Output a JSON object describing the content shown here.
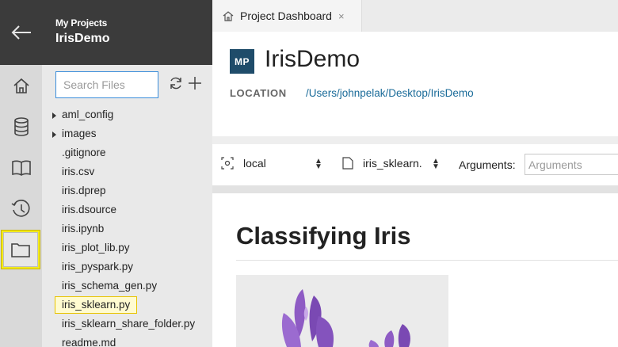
{
  "nav": {
    "back_icon": "arrow-left-icon",
    "items": [
      {
        "icon": "home-icon"
      },
      {
        "icon": "database-icon"
      },
      {
        "icon": "book-icon"
      },
      {
        "icon": "history-icon"
      },
      {
        "icon": "folder-icon",
        "active": true
      }
    ]
  },
  "project": {
    "subtitle": "My Projects",
    "name": "IrisDemo"
  },
  "file_panel": {
    "search_placeholder": "Search Files",
    "files": [
      {
        "name": "aml_config",
        "type": "folder"
      },
      {
        "name": "images",
        "type": "folder"
      },
      {
        "name": ".gitignore",
        "type": "file"
      },
      {
        "name": "iris.csv",
        "type": "file"
      },
      {
        "name": "iris.dprep",
        "type": "file"
      },
      {
        "name": "iris.dsource",
        "type": "file"
      },
      {
        "name": "iris.ipynb",
        "type": "file"
      },
      {
        "name": "iris_plot_lib.py",
        "type": "file"
      },
      {
        "name": "iris_pyspark.py",
        "type": "file"
      },
      {
        "name": "iris_schema_gen.py",
        "type": "file"
      },
      {
        "name": "iris_sklearn.py",
        "type": "file",
        "highlighted": true
      },
      {
        "name": "iris_sklearn_share_folder.py",
        "type": "file"
      },
      {
        "name": "readme.md",
        "type": "file"
      }
    ]
  },
  "tab": {
    "label": "Project Dashboard",
    "close": "×"
  },
  "dashboard": {
    "badge": "MP",
    "title": "IrisDemo",
    "location_label": "LOCATION",
    "location_value": "/Users/johnpelak/Desktop/IrisDemo"
  },
  "run": {
    "target": "local",
    "script": "iris_sklearn.py",
    "script_visible": "iris_sklearn.",
    "arguments_label": "Arguments:",
    "arguments_placeholder": "Arguments"
  },
  "notebook": {
    "title": "Classifying Iris"
  },
  "colors": {
    "dark_header": "#3b3b3b",
    "badge": "#1f4c6a",
    "link": "#1a6b99",
    "highlight": "#f2ea1e",
    "iris_purple": "#8e5bc4"
  }
}
